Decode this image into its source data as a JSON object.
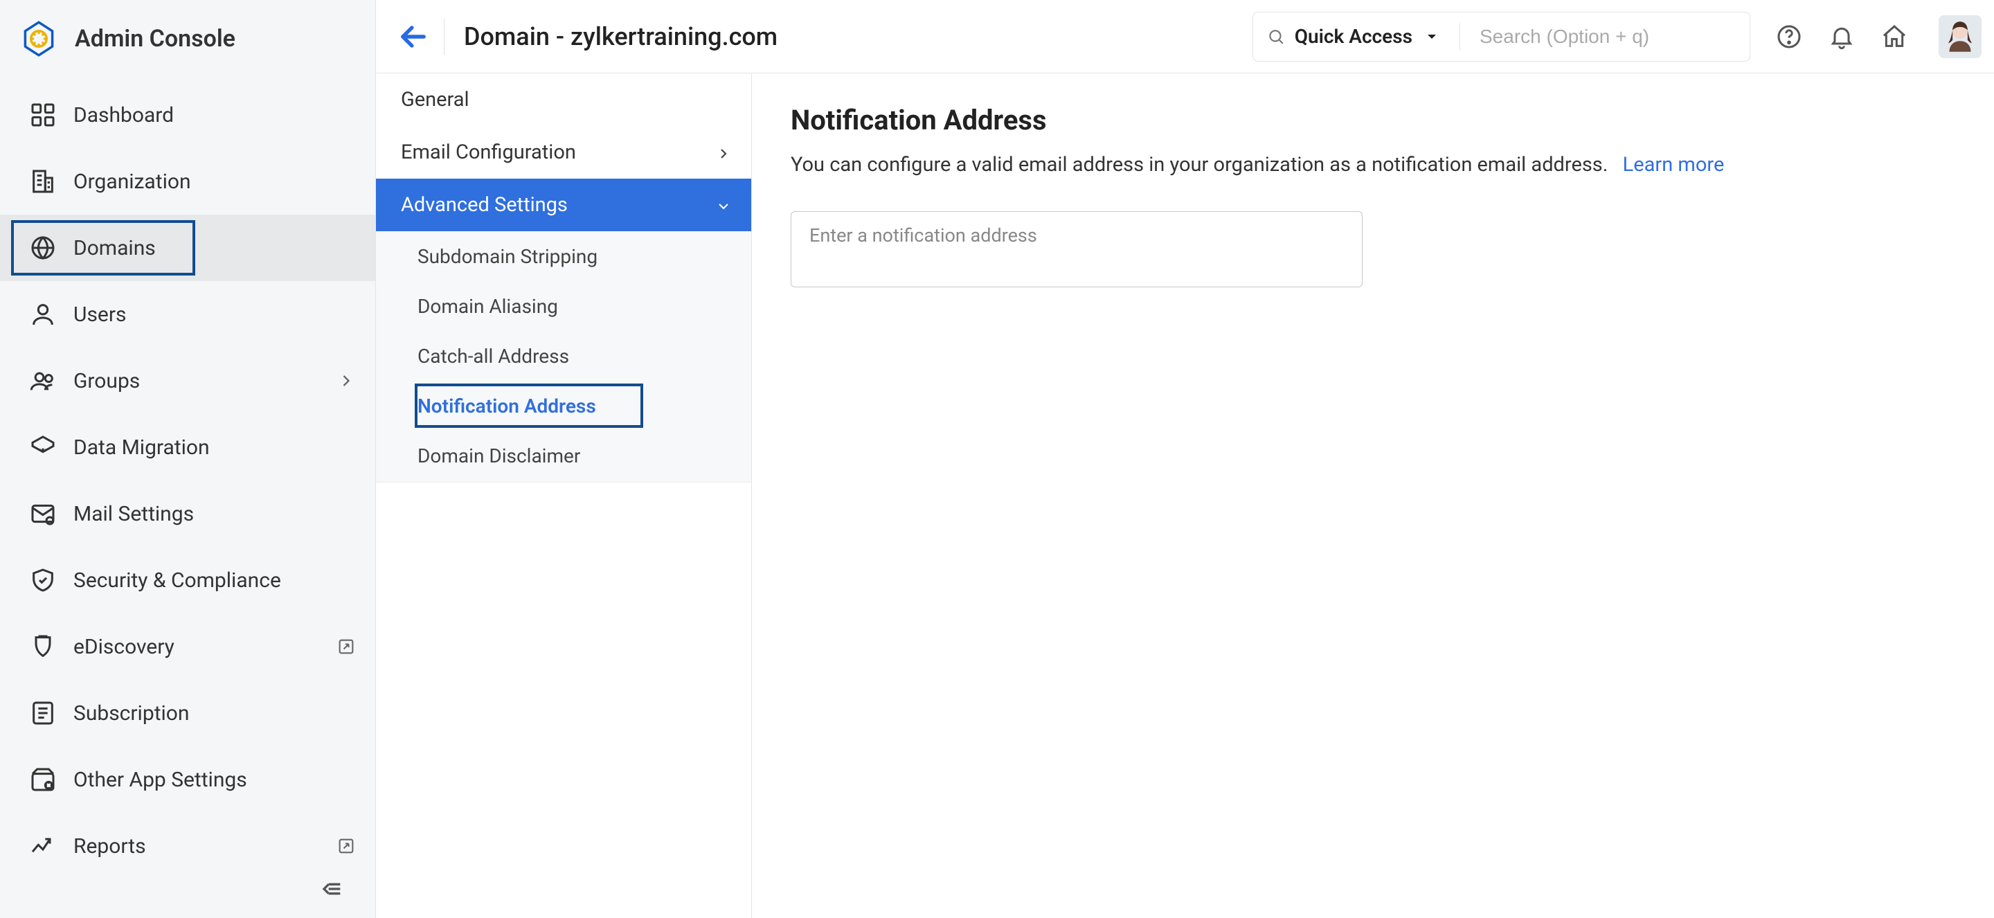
{
  "header": {
    "app_title": "Admin Console",
    "page_title": "Domain - zylkertraining.com",
    "quick_access_label": "Quick Access",
    "search_placeholder": "Search (Option + q)"
  },
  "sidebar": {
    "items": [
      {
        "icon": "dashboard-icon",
        "label": "Dashboard"
      },
      {
        "icon": "organization-icon",
        "label": "Organization"
      },
      {
        "icon": "globe-icon",
        "label": "Domains",
        "active": true
      },
      {
        "icon": "user-icon",
        "label": "Users"
      },
      {
        "icon": "groups-icon",
        "label": "Groups",
        "aux": "chevron-right"
      },
      {
        "icon": "migration-icon",
        "label": "Data Migration"
      },
      {
        "icon": "mail-settings-icon",
        "label": "Mail Settings"
      },
      {
        "icon": "shield-icon",
        "label": "Security & Compliance"
      },
      {
        "icon": "ediscovery-icon",
        "label": "eDiscovery",
        "aux": "external-link"
      },
      {
        "icon": "subscription-icon",
        "label": "Subscription"
      },
      {
        "icon": "apps-icon",
        "label": "Other App Settings"
      },
      {
        "icon": "reports-icon",
        "label": "Reports",
        "aux": "external-link"
      }
    ]
  },
  "subnav": {
    "items": [
      {
        "label": "General"
      },
      {
        "label": "Email Configuration",
        "chev": "right"
      },
      {
        "label": "Advanced Settings",
        "chev": "down",
        "expanded": true
      }
    ],
    "advanced_sub": [
      {
        "label": "Subdomain Stripping"
      },
      {
        "label": "Domain Aliasing"
      },
      {
        "label": "Catch-all Address"
      },
      {
        "label": "Notification Address",
        "selected": true
      },
      {
        "label": "Domain Disclaimer"
      }
    ]
  },
  "panel": {
    "title": "Notification Address",
    "description": "You can configure a valid email address in your organization as a notification email address.",
    "learn_more": "Learn more",
    "input_label": "Enter a notification address"
  }
}
